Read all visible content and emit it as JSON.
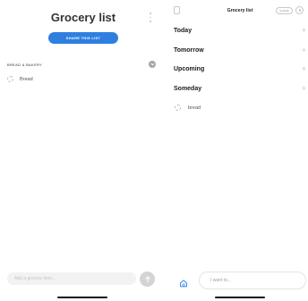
{
  "left": {
    "title": "Grocery list",
    "share_button": "SHARE THIS LIST",
    "section": {
      "header": "BREAD & BAKERY",
      "items": [
        "Bread"
      ]
    },
    "add_placeholder": "Add a grocery item..."
  },
  "right": {
    "title": "Grocery list",
    "share_label": "SHARE",
    "categories": [
      "Today",
      "Tomorrow",
      "Upcoming",
      "Someday"
    ],
    "items": [
      "bread"
    ],
    "input_placeholder": "I want to..."
  },
  "icons": {
    "left_menu": "more-vertical-icon",
    "section_toggle": "chevron-down-icon",
    "send": "arrow-up-icon",
    "right_sidebar": "sidebar-icon",
    "add": "plus-icon",
    "home": "home-icon",
    "avatar": "user-icon"
  },
  "colors": {
    "accent": "#2e7fe0",
    "text_dark": "#333333",
    "muted": "#c8c8c8"
  }
}
